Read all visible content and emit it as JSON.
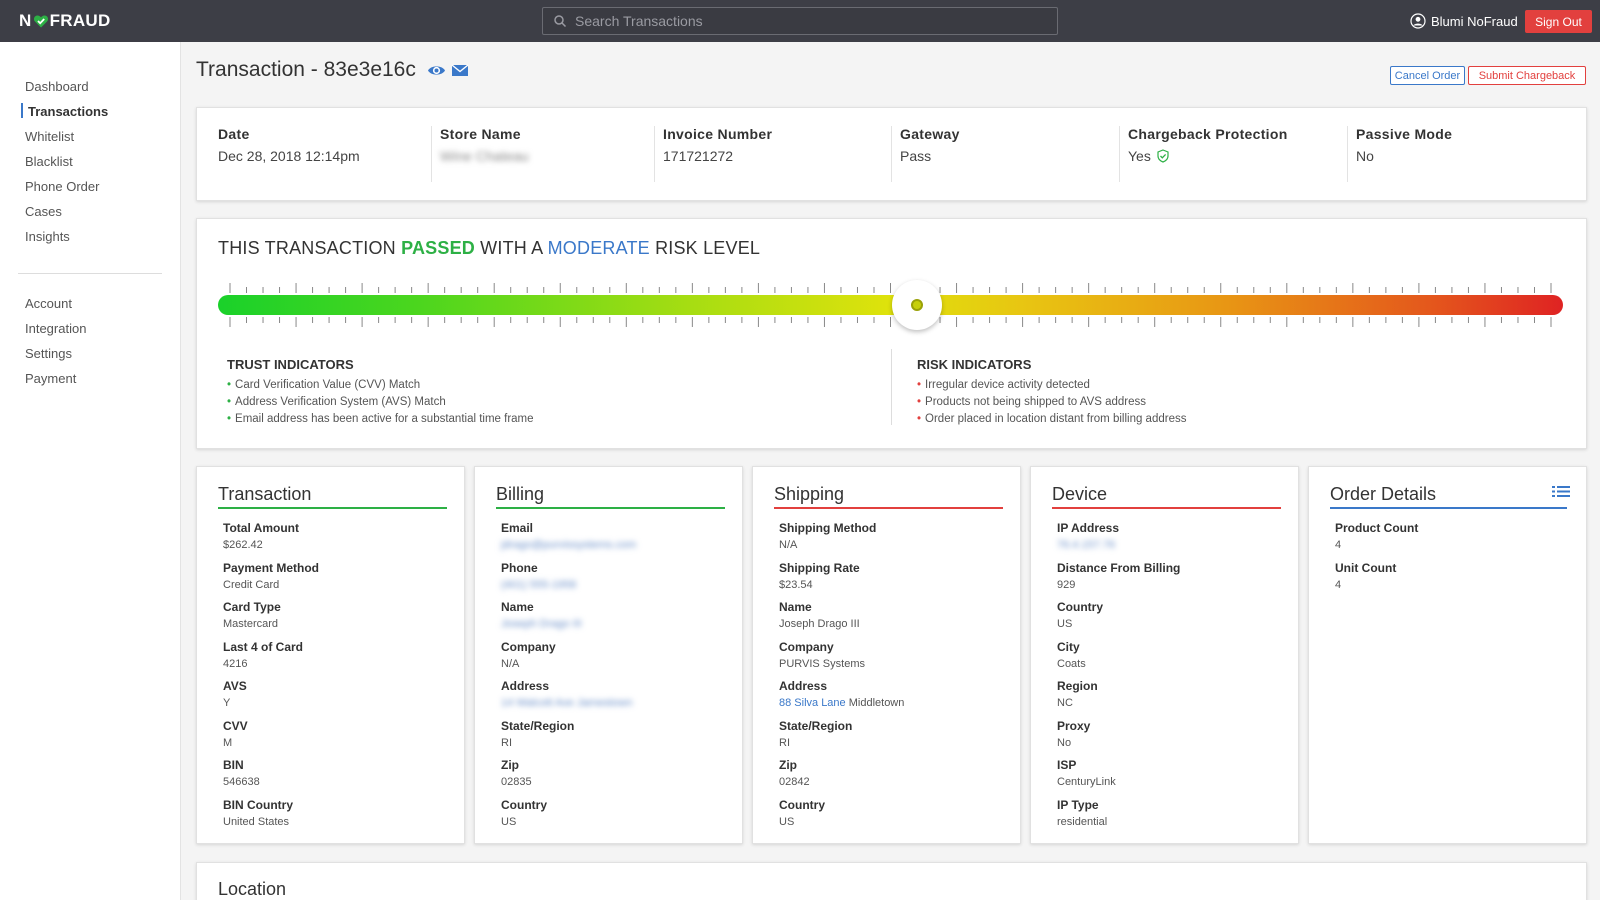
{
  "topbar": {
    "logo_left": "N",
    "logo_right": "FRAUD",
    "search_placeholder": "Search Transactions",
    "user_name": "Blumi NoFraud",
    "sign_out": "Sign Out"
  },
  "sidebar": {
    "items": [
      "Dashboard",
      "Transactions",
      "Whitelist",
      "Blacklist",
      "Phone Order",
      "Cases",
      "Insights"
    ],
    "items2": [
      "Account",
      "Integration",
      "Settings",
      "Payment"
    ]
  },
  "header": {
    "title": "Transaction - 83e3e16c",
    "cancel_order": "Cancel Order",
    "submit_chargeback": "Submit Chargeback"
  },
  "summary": {
    "date_label": "Date",
    "date_value": "Dec 28, 2018 12:14pm",
    "store_label": "Store Name",
    "store_value": "Wine Chateau",
    "invoice_label": "Invoice Number",
    "invoice_value": "171721272",
    "gateway_label": "Gateway",
    "gateway_value": "Pass",
    "cbp_label": "Chargeback Protection",
    "cbp_value": "Yes",
    "passive_label": "Passive Mode",
    "passive_value": "No"
  },
  "risk": {
    "title_pre": "THIS TRANSACTION ",
    "title_pass": "PASSED",
    "title_mid": " WITH A ",
    "title_level": "MODERATE",
    "title_post": " RISK LEVEL",
    "gauge_position": 0.52,
    "colors": {
      "pass": "#2db045",
      "level": "#3a78c9",
      "low": "#1ad12a",
      "high": "#df2323"
    },
    "trust_title": "TRUST INDICATORS",
    "trust": [
      "Card Verification Value (CVV) Match",
      "Address Verification System (AVS) Match",
      "Email address has been active for a substantial time frame"
    ],
    "risk_title": "RISK INDICATORS",
    "risks": [
      "Irregular device activity detected",
      "Products not being shipped to AVS address",
      "Order placed in location distant from billing address"
    ]
  },
  "transaction": {
    "title": "Transaction",
    "fields": [
      {
        "label": "Total Amount",
        "value": "$262.42"
      },
      {
        "label": "Payment Method",
        "value": "Credit Card"
      },
      {
        "label": "Card Type",
        "value": "Mastercard"
      },
      {
        "label": "Last 4 of Card",
        "value": "4216"
      },
      {
        "label": "AVS",
        "value": "Y"
      },
      {
        "label": "CVV",
        "value": "M"
      },
      {
        "label": "BIN",
        "value": "546638"
      },
      {
        "label": "BIN Country",
        "value": "United States"
      }
    ]
  },
  "billing": {
    "title": "Billing",
    "fields": [
      {
        "label": "Email",
        "value": "jdrago@purvissystems.com"
      },
      {
        "label": "Phone",
        "value": "(401) 555-1958"
      },
      {
        "label": "Name",
        "value": "Joseph Drago III"
      },
      {
        "label": "Company",
        "value": "N/A"
      },
      {
        "label": "Address",
        "value": "14 Walcott Ave  Jamestown"
      },
      {
        "label": "State/Region",
        "value": "RI"
      },
      {
        "label": "Zip",
        "value": "02835"
      },
      {
        "label": "Country",
        "value": "US"
      }
    ]
  },
  "shipping": {
    "title": "Shipping",
    "fields": [
      {
        "label": "Shipping Method",
        "value": "N/A"
      },
      {
        "label": "Shipping Rate",
        "value": "$23.54"
      },
      {
        "label": "Name",
        "value": "Joseph Drago III"
      },
      {
        "label": "Company",
        "value": "PURVIS Systems"
      },
      {
        "label": "Address",
        "value": "Middletown",
        "link": "88 Silva Lane"
      },
      {
        "label": "State/Region",
        "value": "RI"
      },
      {
        "label": "Zip",
        "value": "02842"
      },
      {
        "label": "Country",
        "value": "US"
      }
    ]
  },
  "device": {
    "title": "Device",
    "fields": [
      {
        "label": "IP Address",
        "value": "76.4.157.76"
      },
      {
        "label": "Distance From Billing",
        "value": "929"
      },
      {
        "label": "Country",
        "value": "US"
      },
      {
        "label": "City",
        "value": "Coats"
      },
      {
        "label": "Region",
        "value": "NC"
      },
      {
        "label": "Proxy",
        "value": "No"
      },
      {
        "label": "ISP",
        "value": "CenturyLink"
      },
      {
        "label": "IP Type",
        "value": "residential"
      }
    ]
  },
  "order": {
    "title": "Order Details",
    "fields": [
      {
        "label": "Product Count",
        "value": "4"
      },
      {
        "label": "Unit Count",
        "value": "4"
      }
    ]
  },
  "location": {
    "title": "Location"
  }
}
